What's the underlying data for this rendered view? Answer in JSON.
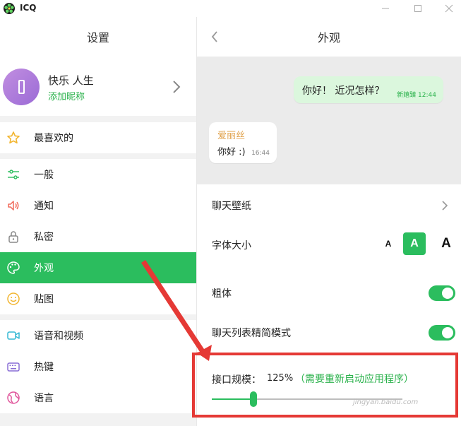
{
  "app": {
    "title": "ICQ",
    "window_controls": [
      "minimize",
      "maximize",
      "close"
    ]
  },
  "sidebar": {
    "title": "设置",
    "profile": {
      "name": "快乐 人生",
      "subtitle": "添加昵称"
    },
    "favorites": {
      "label": "最喜欢的",
      "icon": "star-icon"
    },
    "items": [
      {
        "label": "一般",
        "icon": "sliders-icon",
        "active": false
      },
      {
        "label": "通知",
        "icon": "speaker-icon",
        "active": false
      },
      {
        "label": "私密",
        "icon": "lock-icon",
        "active": false
      },
      {
        "label": "外观",
        "icon": "palette-icon",
        "active": true
      },
      {
        "label": "贴图",
        "icon": "smiley-icon",
        "active": false
      }
    ],
    "items2": [
      {
        "label": "语音和视频",
        "icon": "video-camera-icon"
      },
      {
        "label": "热键",
        "icon": "keyboard-icon"
      },
      {
        "label": "语言",
        "icon": "globe-icon"
      }
    ]
  },
  "main": {
    "title": "外观",
    "preview": {
      "outgoing": {
        "text": "你好！ 近况怎样？",
        "meta": "新嬉臻 12:44"
      },
      "incoming": {
        "sender": "爱丽丝",
        "text": "你好 :)",
        "time": "16:44"
      }
    },
    "settings": {
      "wallpaper": "聊天壁纸",
      "font_size": {
        "label": "字体大小",
        "options": [
          "A",
          "A",
          "A"
        ],
        "selected_index": 1
      },
      "bold": {
        "label": "粗体",
        "enabled": true
      },
      "compact": {
        "label": "聊天列表精简模式",
        "enabled": true
      },
      "scale": {
        "label": "接口规模：",
        "value": "125%",
        "note": "（需要重新启动应用程序）",
        "slider_level": 0.22
      }
    }
  },
  "overlay": {
    "highlight_color": "#e53935",
    "watermark": "jingyan.baidu.com"
  },
  "colors": {
    "accent": "#2bbd5e",
    "accent_text": "#2bb24c",
    "sender": "#e0a14a"
  }
}
